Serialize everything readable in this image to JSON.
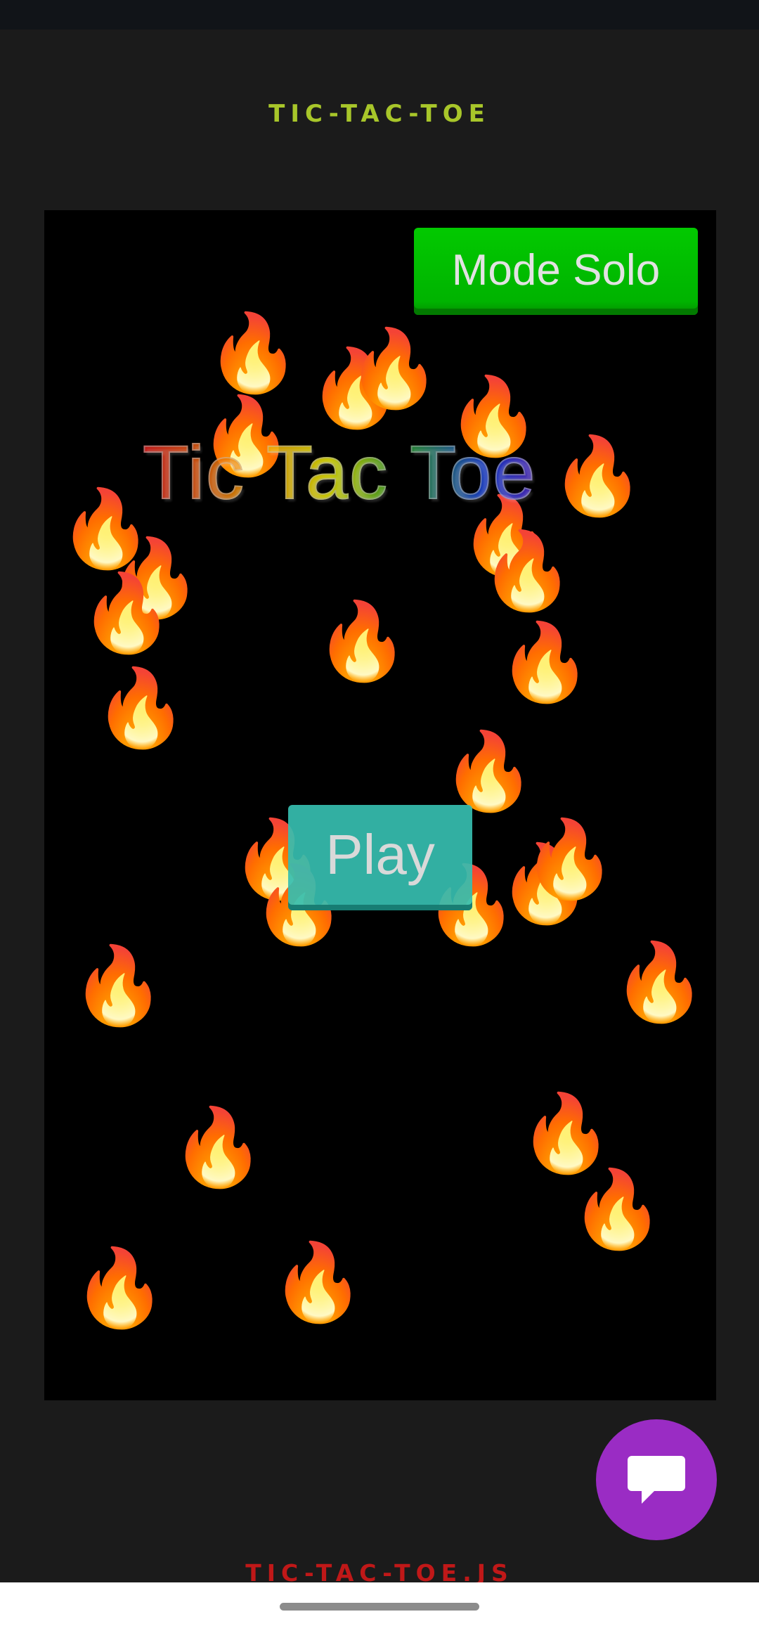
{
  "header": {
    "title": "TIC-TAC-TOE"
  },
  "game": {
    "mode_button_label": "Mode Solo",
    "title": "Tic Tac Toe",
    "play_button_label": "Play",
    "flame_glyph": "🔥"
  },
  "chat": {
    "icon": "chat-bubble-icon"
  },
  "footer": {
    "text": "TIC-TAC-TOE.JS"
  },
  "colors": {
    "header_accent": "#a8c62a",
    "mode_button": "#00b300",
    "play_button": "#36beb0",
    "chat_fab": "#9a2cc4",
    "footer_text": "#c01818",
    "canvas_bg": "#000000"
  }
}
